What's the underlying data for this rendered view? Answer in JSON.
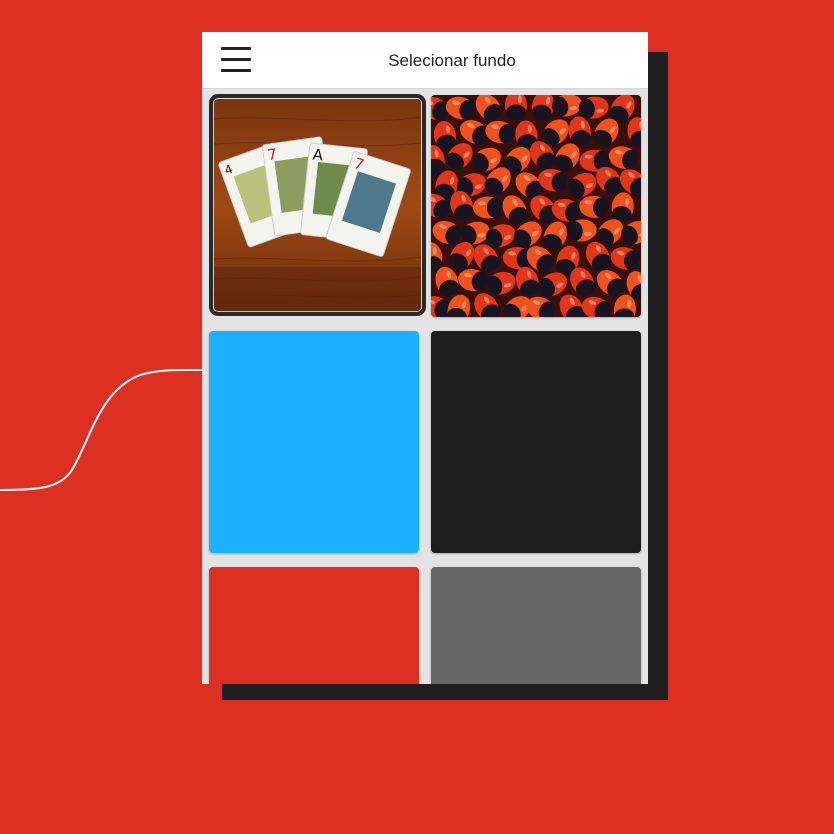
{
  "header": {
    "title": "Selecionar fundo",
    "menu_icon": "hamburger-menu-icon"
  },
  "backgrounds": [
    {
      "kind": "image",
      "subject": "playing-cards",
      "selected": true
    },
    {
      "kind": "image",
      "subject": "red-black-seeds",
      "selected": false
    },
    {
      "kind": "color",
      "color": "#1bb1ff",
      "selected": false
    },
    {
      "kind": "color",
      "color": "#1e1e1e",
      "selected": false
    },
    {
      "kind": "color",
      "color": "#de3022",
      "selected": false
    },
    {
      "kind": "color",
      "color": "#666666",
      "selected": false
    }
  ],
  "colors": {
    "page_background": "#de3022",
    "window_shadow": "#1e1e1e",
    "appbar": "#ffffff",
    "grid_background": "#e3e3e3"
  }
}
